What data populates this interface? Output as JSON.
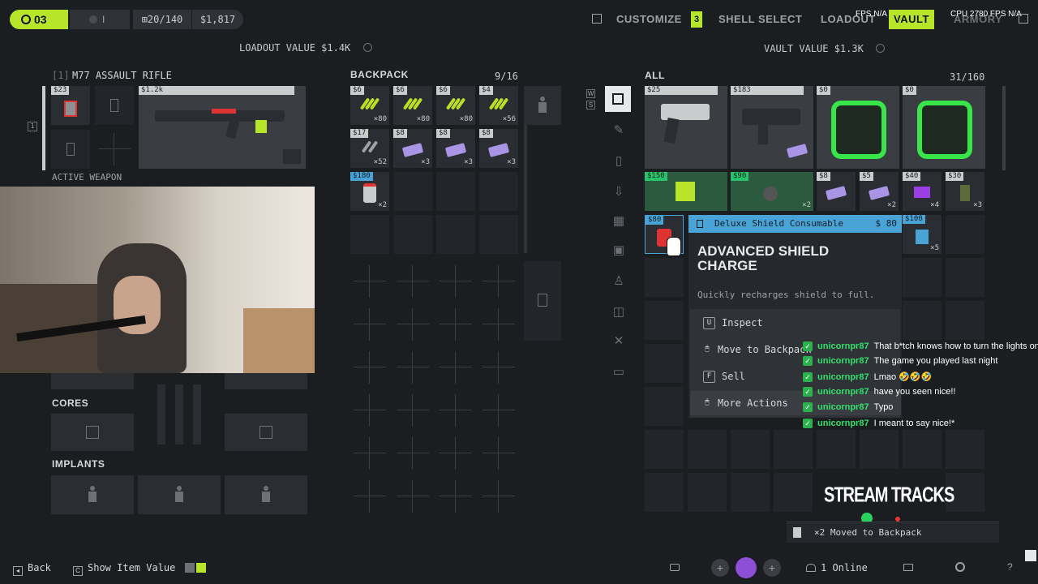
{
  "top_bar": {
    "level": "03",
    "level_badge_color": "#b6e52a",
    "slot2_label": "I",
    "capacity": "⊞20/140",
    "currency": "$1,817",
    "nav": {
      "customize": "CUSTOMIZE",
      "customize_badge": "3",
      "shell_select": "SHELL SELECT",
      "loadout": "LOADOUT",
      "vault": "VAULT",
      "armory": "ARMORY"
    },
    "fps_label": "FPS N/A",
    "cpu_label": "CPU 2780 FPS N/A"
  },
  "loadout": {
    "value_label": "LOADOUT VALUE $1.4K",
    "weapon_slot": "[1]",
    "weapon_name": "M77 ASSAULT RIFLE",
    "active_weapon_label": "ACTIVE WEAPON",
    "weapon_price": "$1.2k",
    "mod_price": "$23",
    "slot_index": "1",
    "cores_label": "CORES",
    "implants_label": "IMPLANTS"
  },
  "backpack": {
    "title": "BACKPACK",
    "count": "9/16",
    "items": [
      {
        "price": "$6",
        "qty": "×80",
        "kind": "ammo"
      },
      {
        "price": "$6",
        "qty": "×80",
        "kind": "ammo"
      },
      {
        "price": "$6",
        "qty": "×80",
        "kind": "ammo"
      },
      {
        "price": "$4",
        "qty": "×56",
        "kind": "ammo"
      },
      {
        "price": "$17",
        "qty": "×52",
        "kind": "ammo-grey"
      },
      {
        "price": "$8",
        "qty": "×3",
        "kind": "mod"
      },
      {
        "price": "$8",
        "qty": "×3",
        "kind": "mod"
      },
      {
        "price": "$8",
        "qty": "×3",
        "kind": "mod"
      },
      {
        "price": "$180",
        "qty": "×2",
        "kind": "shield"
      }
    ]
  },
  "vault": {
    "value_label": "VAULT VALUE $1.3K",
    "filter_label": "ALL",
    "count": "31/160",
    "row1": [
      {
        "price": "$25"
      },
      {
        "price": "$183"
      },
      {
        "price": "$0"
      },
      {
        "price": "$0"
      }
    ],
    "row2": [
      {
        "price": "$150",
        "qty": ""
      },
      {
        "price": "$90",
        "qty": "×2"
      },
      {
        "price": "$8",
        "qty": ""
      },
      {
        "price": "$5",
        "qty": "×2"
      },
      {
        "price": "$40",
        "qty": "×4"
      },
      {
        "price": "$30",
        "qty": "×3"
      }
    ],
    "row3": [
      {
        "price": "$80",
        "qty": ""
      },
      {
        "price": "$100",
        "qty": "×5"
      }
    ]
  },
  "tooltip": {
    "category": "Deluxe Shield Consumable",
    "price": "$ 80",
    "name_line1": "ADVANCED SHIELD",
    "name_line2": "CHARGE",
    "description": "Quickly recharges shield to full.",
    "actions": [
      {
        "key": "U",
        "label": "Inspect"
      },
      {
        "key": "🖱",
        "label": "Move to Backpack"
      },
      {
        "key": "F",
        "label": "Sell"
      },
      {
        "key": "🖱",
        "label": "More Actions"
      }
    ]
  },
  "chat": [
    {
      "user": "unicornpr87",
      "msg": "That b*tch knows how to turn the lights on"
    },
    {
      "user": "unicornpr87",
      "msg": "The game you played last night"
    },
    {
      "user": "unicornpr87",
      "msg": "Lmao 🤣🤣🤣"
    },
    {
      "user": "unicornpr87",
      "msg": "have you seen nice!!"
    },
    {
      "user": "unicornpr87",
      "msg": "Typo"
    },
    {
      "user": "unicornpr87",
      "msg": "I meant to say nice!*"
    }
  ],
  "stream_tracks": "STREAM TRACKS",
  "notification": "×2 Moved to Backpack",
  "bottom_bar": {
    "back": "Back",
    "show_value": "Show Item Value",
    "online": "1 Online"
  }
}
